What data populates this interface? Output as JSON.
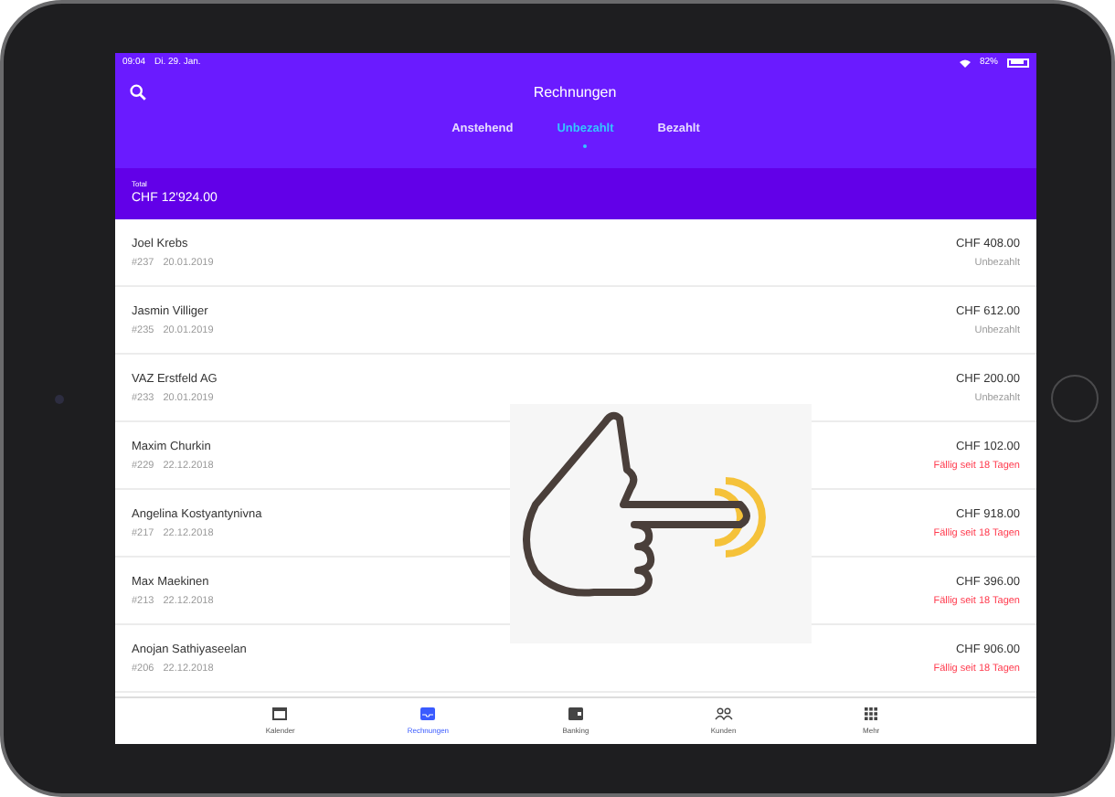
{
  "status_bar": {
    "time": "09:04",
    "date": "Di. 29. Jan.",
    "battery": "82%"
  },
  "header": {
    "title": "Rechnungen"
  },
  "tabs": [
    {
      "label": "Anstehend",
      "selected": false
    },
    {
      "label": "Unbezahlt",
      "selected": true
    },
    {
      "label": "Bezahlt",
      "selected": false
    }
  ],
  "total": {
    "label": "Total",
    "value": "CHF 12'924.00"
  },
  "invoices": [
    {
      "name": "Joel Krebs",
      "number": "#237",
      "date": "20.01.2019",
      "amount": "CHF 408.00",
      "status": "Unbezahlt",
      "kind": "unpaid"
    },
    {
      "name": "Jasmin Villiger",
      "number": "#235",
      "date": "20.01.2019",
      "amount": "CHF 612.00",
      "status": "Unbezahlt",
      "kind": "unpaid"
    },
    {
      "name": "VAZ Erstfeld AG",
      "number": "#233",
      "date": "20.01.2019",
      "amount": "CHF 200.00",
      "status": "Unbezahlt",
      "kind": "unpaid"
    },
    {
      "name": "Maxim Churkin",
      "number": "#229",
      "date": "22.12.2018",
      "amount": "CHF 102.00",
      "status": "Fällig seit 18 Tagen",
      "kind": "overdue"
    },
    {
      "name": "Angelina Kostyantynivna",
      "number": "#217",
      "date": "22.12.2018",
      "amount": "CHF 918.00",
      "status": "Fällig seit 18 Tagen",
      "kind": "overdue"
    },
    {
      "name": "Max Maekinen",
      "number": "#213",
      "date": "22.12.2018",
      "amount": "CHF 396.00",
      "status": "Fällig seit 18 Tagen",
      "kind": "overdue"
    },
    {
      "name": "Anojan Sathiyaseelan",
      "number": "#206",
      "date": "22.12.2018",
      "amount": "CHF 906.00",
      "status": "Fällig seit 18 Tagen",
      "kind": "overdue"
    }
  ],
  "tab_bar": [
    {
      "label": "Kalender",
      "kind": "calendar",
      "selected": false
    },
    {
      "label": "Rechnungen",
      "kind": "inbox",
      "selected": true
    },
    {
      "label": "Banking",
      "kind": "wallet",
      "selected": false
    },
    {
      "label": "Kunden",
      "kind": "people",
      "selected": false
    },
    {
      "label": "Mehr",
      "kind": "grid",
      "selected": false
    }
  ]
}
